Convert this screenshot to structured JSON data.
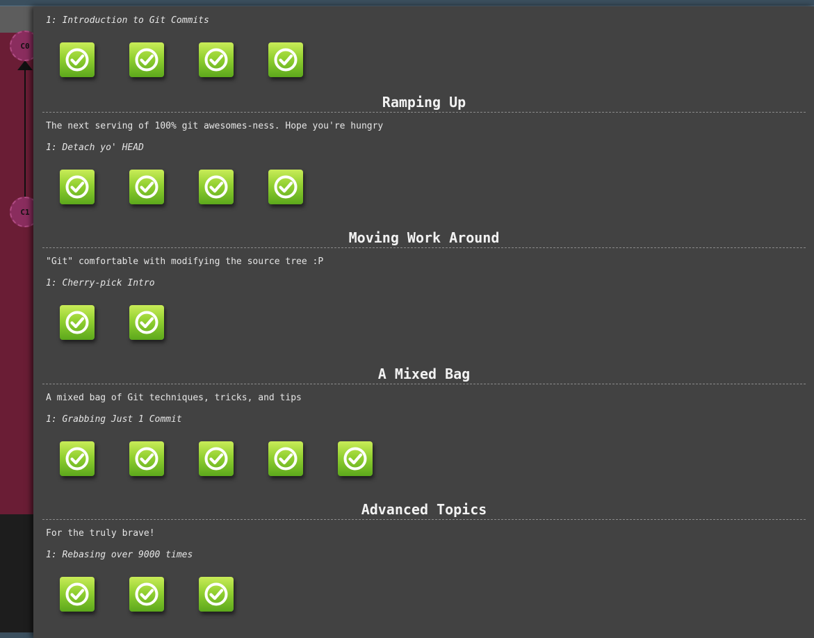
{
  "background": {
    "commits": [
      "C0",
      "C1"
    ],
    "canvas_color": "#6a1d35"
  },
  "level_icon": "check-icon",
  "accent_color": "#92d031",
  "sequences": [
    {
      "title": "",
      "description": "",
      "first_level_name": "1: Introduction to Git Commits",
      "completed_levels": 4
    },
    {
      "title": "Ramping Up",
      "description": "The next serving of 100% git awesomes-ness. Hope you're hungry",
      "first_level_name": "1: Detach yo' HEAD",
      "completed_levels": 4
    },
    {
      "title": "Moving Work Around",
      "description": "\"Git\" comfortable with modifying the source tree :P",
      "first_level_name": "1: Cherry-pick Intro",
      "completed_levels": 2
    },
    {
      "title": "A Mixed Bag",
      "description": "A mixed bag of Git techniques, tricks, and tips",
      "first_level_name": "1: Grabbing Just 1 Commit",
      "completed_levels": 5
    },
    {
      "title": "Advanced Topics",
      "description": "For the truly brave!",
      "first_level_name": "1: Rebasing over 9000 times",
      "completed_levels": 3
    }
  ]
}
